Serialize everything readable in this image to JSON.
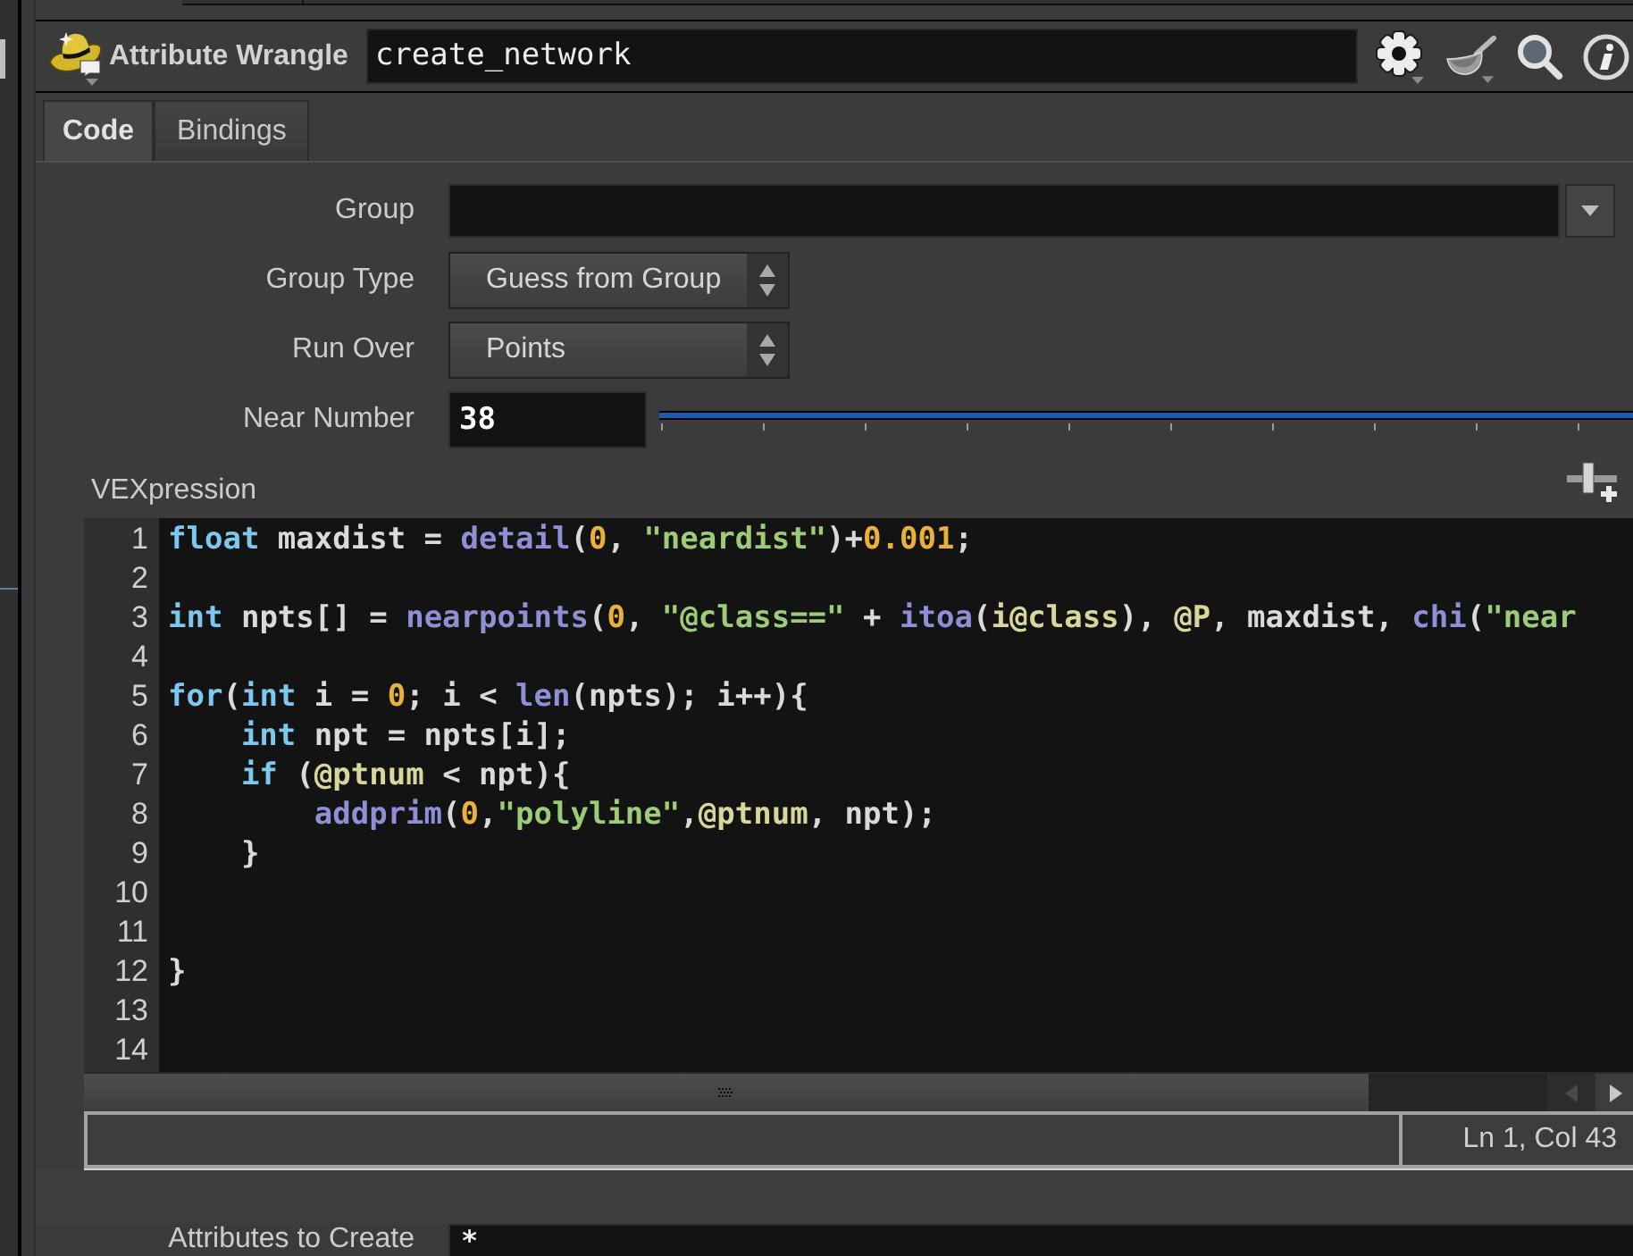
{
  "header": {
    "node_type": "Attribute Wrangle",
    "node_name": "create_network"
  },
  "tabs": [
    {
      "label": "Code",
      "selected": true
    },
    {
      "label": "Bindings",
      "selected": false
    }
  ],
  "parameters": [
    {
      "kind": "menu_field",
      "label": "Group"
    },
    {
      "kind": "dropdown",
      "label": "Group Type",
      "value": "Guess from Group"
    },
    {
      "kind": "dropdown",
      "label": "Run Over",
      "value": "Points"
    },
    {
      "kind": "slider",
      "label": "Near Number",
      "value": "38",
      "level": 1
    }
  ],
  "vexpression": {
    "label": "VEXpression",
    "lines": [
      {
        "number": "1",
        "tokens": [
          {
            "kind": "keyword",
            "text": "float"
          },
          {
            "kind": "plain",
            "text": " maxdist = "
          },
          {
            "kind": "function",
            "text": "detail"
          },
          {
            "kind": "plain",
            "text": "("
          },
          {
            "kind": "number",
            "text": "0"
          },
          {
            "kind": "plain",
            "text": ", "
          },
          {
            "kind": "string",
            "text": "\"neardist\""
          },
          {
            "kind": "plain",
            "text": ")+"
          },
          {
            "kind": "number",
            "text": "0.001"
          },
          {
            "kind": "plain",
            "text": ";"
          }
        ]
      },
      {
        "number": "2"
      },
      {
        "number": "3",
        "tokens": [
          {
            "kind": "keyword",
            "text": "int"
          },
          {
            "kind": "plain",
            "text": " npts[] = "
          },
          {
            "kind": "function",
            "text": "nearpoints"
          },
          {
            "kind": "plain",
            "text": "("
          },
          {
            "kind": "number",
            "text": "0"
          },
          {
            "kind": "plain",
            "text": ", "
          },
          {
            "kind": "string",
            "text": "\"@class==\""
          },
          {
            "kind": "plain",
            "text": " + "
          },
          {
            "kind": "function",
            "text": "itoa"
          },
          {
            "kind": "plain",
            "text": "("
          },
          {
            "kind": "attribute",
            "text": "i@class"
          },
          {
            "kind": "plain",
            "text": "), "
          },
          {
            "kind": "attribute",
            "text": "@P"
          },
          {
            "kind": "plain",
            "text": ", maxdist, "
          },
          {
            "kind": "function",
            "text": "chi"
          },
          {
            "kind": "plain",
            "text": "("
          },
          {
            "kind": "string",
            "text": "\"near"
          }
        ]
      },
      {
        "number": "4"
      },
      {
        "number": "5",
        "tokens": [
          {
            "kind": "keyword",
            "text": "for"
          },
          {
            "kind": "plain",
            "text": "("
          },
          {
            "kind": "keyword",
            "text": "int"
          },
          {
            "kind": "plain",
            "text": " i = "
          },
          {
            "kind": "number",
            "text": "0"
          },
          {
            "kind": "plain",
            "text": "; i < "
          },
          {
            "kind": "function",
            "text": "len"
          },
          {
            "kind": "plain",
            "text": "(npts); i++){"
          }
        ],
        "children": [
          {
            "number": "6",
            "tokens": [
              {
                "kind": "keyword",
                "text": "int"
              },
              {
                "kind": "plain",
                "text": " npt = npts[i];"
              }
            ]
          },
          {
            "number": "7",
            "tokens": [
              {
                "kind": "keyword",
                "text": "if"
              },
              {
                "kind": "plain",
                "text": " ("
              },
              {
                "kind": "attribute",
                "text": "@ptnum"
              },
              {
                "kind": "plain",
                "text": " < npt){"
              }
            ],
            "children": [
              {
                "number": "8",
                "tokens": [
                  {
                    "kind": "function",
                    "text": "addprim"
                  },
                  {
                    "kind": "plain",
                    "text": "("
                  },
                  {
                    "kind": "number",
                    "text": "0"
                  },
                  {
                    "kind": "plain",
                    "text": ","
                  },
                  {
                    "kind": "string",
                    "text": "\"polyline\""
                  },
                  {
                    "kind": "plain",
                    "text": ","
                  },
                  {
                    "kind": "attribute",
                    "text": "@ptnum"
                  },
                  {
                    "kind": "plain",
                    "text": ", npt);"
                  }
                ]
              }
            ]
          },
          {
            "number": "9",
            "tokens": [
              {
                "kind": "plain",
                "text": "}"
              }
            ]
          }
        ]
      },
      {
        "number": "10"
      },
      {
        "number": "11"
      },
      {
        "number": "12",
        "tokens": [
          {
            "kind": "plain",
            "text": "}"
          }
        ]
      },
      {
        "number": "13"
      },
      {
        "number": "14"
      }
    ],
    "status": "Ln 1, Col 43"
  },
  "attributes_to_create": {
    "label": "Attributes to Create",
    "value": "*"
  }
}
